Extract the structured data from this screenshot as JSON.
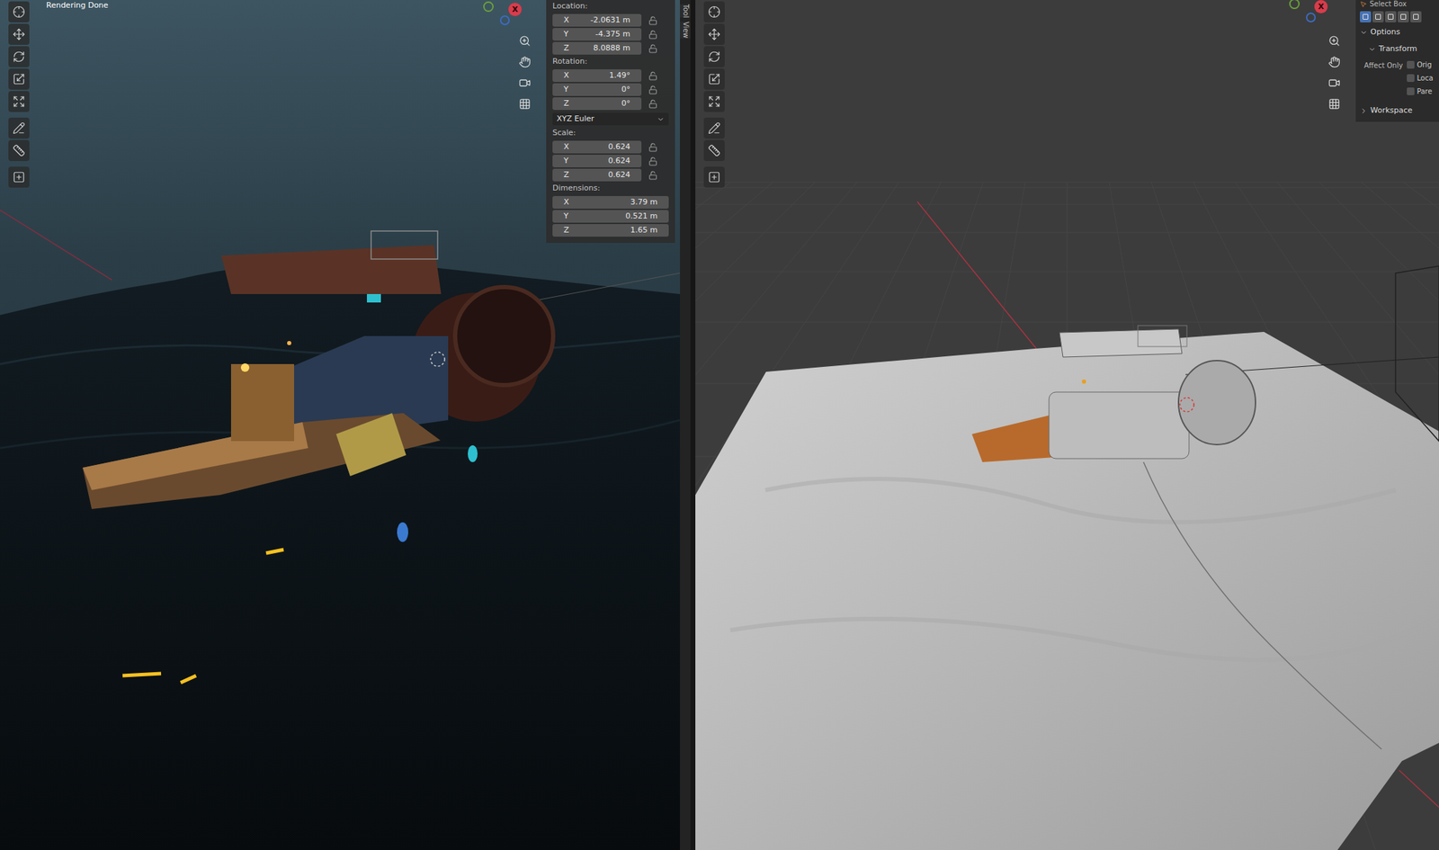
{
  "left_viewport": {
    "status": "Rendering Done",
    "gizmo_label": "X"
  },
  "sidebar_tabs": [
    {
      "label": "Tool",
      "selected": false
    },
    {
      "label": "View",
      "selected": false
    }
  ],
  "sidebar": {
    "groups": [
      {
        "label": "Location:",
        "lockable": true,
        "fields": [
          {
            "axis": "X",
            "value": "-2.0631 m",
            "locked": false
          },
          {
            "axis": "Y",
            "value": "-4.375 m",
            "locked": false
          },
          {
            "axis": "Z",
            "value": "8.0888 m",
            "locked": false
          }
        ]
      },
      {
        "label": "Rotation:",
        "lockable": true,
        "mode": "XYZ Euler",
        "fields": [
          {
            "axis": "X",
            "value": "1.49°",
            "locked": false
          },
          {
            "axis": "Y",
            "value": "0°",
            "locked": false
          },
          {
            "axis": "Z",
            "value": "0°",
            "locked": false
          }
        ]
      },
      {
        "label": "Scale:",
        "lockable": true,
        "fields": [
          {
            "axis": "X",
            "value": "0.624",
            "locked": false
          },
          {
            "axis": "Y",
            "value": "0.624",
            "locked": false
          },
          {
            "axis": "Z",
            "value": "0.624",
            "locked": false
          }
        ]
      },
      {
        "label": "Dimensions:",
        "lockable": false,
        "fields": [
          {
            "axis": "X",
            "value": "3.79 m",
            "locked": false
          },
          {
            "axis": "Y",
            "value": "0.521 m",
            "locked": false
          },
          {
            "axis": "Z",
            "value": "1.65 m",
            "locked": false
          }
        ]
      }
    ]
  },
  "right_viewport": {
    "gizmo_label": "X",
    "tool_settings": {
      "title": "Select Box",
      "select_modes": [
        {
          "selected": true
        },
        {
          "selected": false
        },
        {
          "selected": false
        },
        {
          "selected": false
        },
        {
          "selected": false
        }
      ],
      "sections": [
        {
          "label": "Options",
          "expanded": true
        },
        {
          "label": "Transform",
          "expanded": true
        }
      ],
      "affect_only": {
        "label": "Affect Only",
        "options": [
          {
            "label": "Orig",
            "checked": false
          },
          {
            "label": "Loca",
            "checked": false
          },
          {
            "label": "Pare",
            "checked": false
          }
        ]
      },
      "footer": {
        "label": "Workspace",
        "expanded": false
      }
    }
  }
}
